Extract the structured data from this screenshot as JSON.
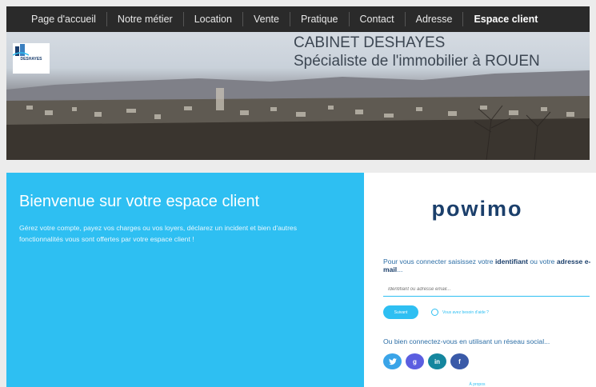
{
  "nav": {
    "items": [
      {
        "label": "Page d'accueil"
      },
      {
        "label": "Notre métier"
      },
      {
        "label": "Location"
      },
      {
        "label": "Vente"
      },
      {
        "label": "Pratique"
      },
      {
        "label": "Contact"
      },
      {
        "label": "Adresse"
      },
      {
        "label": "Espace client"
      }
    ],
    "active_index": 7
  },
  "banner": {
    "logo_text": "DESHAYES",
    "title_line1": "CABINET DESHAYES",
    "title_line2": "Spécialiste de l'immobilier à ROUEN"
  },
  "welcome": {
    "title": "Bienvenue sur votre espace client",
    "subtitle": "Gérez votre compte, payez vos charges ou vos loyers, déclarez un incident et bien d'autres fonctionnalités vous sont offertes par votre espace client !"
  },
  "login": {
    "brand": "powimo",
    "intro_prefix": "Pour vous connecter saisissez votre ",
    "intro_bold1": "identifiant",
    "intro_mid": " ou votre ",
    "intro_bold2": "adresse e-mail",
    "intro_suffix": "...",
    "input_placeholder": "Identifiant ou adresse email...",
    "submit_label": "Suivant",
    "help_label": "Vous avez besoin d'aide ?",
    "social_text": "Ou bien connectez-vous en utilisant un réseau social...",
    "socials": [
      {
        "label": "",
        "icon": "twitter-icon",
        "color": "#3aa4e8"
      },
      {
        "label": "g",
        "icon": "google-icon",
        "color": "#5b5ee0"
      },
      {
        "label": "in",
        "icon": "linkedin-icon",
        "color": "#14869e"
      },
      {
        "label": "f",
        "icon": "facebook-icon",
        "color": "#3a5aa8"
      }
    ],
    "about_label": "À propos"
  },
  "colors": {
    "accent": "#2ebff2",
    "brand": "#1b3f6b",
    "nav_bg": "#2a2a2a"
  }
}
